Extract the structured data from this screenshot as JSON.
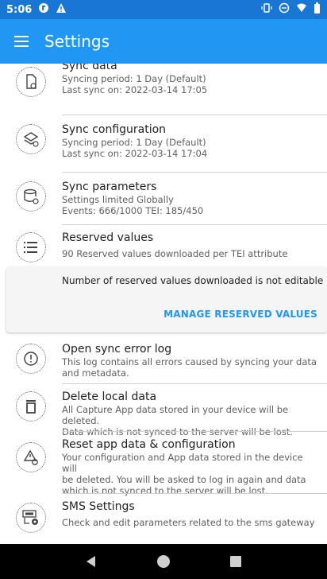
{
  "status_bar": {
    "time": "5:06"
  },
  "app_bar": {
    "title": "Settings"
  },
  "items": [
    {
      "title": "Sync data",
      "lines": [
        "Syncing period: 1 Day (Default)",
        "Last sync on: 2022-03-14 17:05"
      ],
      "icon": "sync-data-icon"
    },
    {
      "title": "Sync configuration",
      "lines": [
        "Syncing period: 1 Day (Default)",
        "Last sync on: 2022-03-14 17:04"
      ],
      "icon": "sync-configuration-icon"
    },
    {
      "title": "Sync parameters",
      "lines": [
        "Settings limited Globally",
        "Events: 666/1000 TEI: 185/450"
      ],
      "icon": "sync-parameters-icon"
    },
    {
      "title": "Reserved values",
      "lines": [
        "90 Reserved values downloaded per TEI attribute"
      ],
      "icon": "list-icon"
    },
    {
      "title": "Open sync error log",
      "lines": [
        "This log contains all errors caused by syncing your data",
        "and metadata."
      ],
      "icon": "error-icon"
    },
    {
      "title": "Delete local data",
      "lines": [
        "All Capture App data stored in your device will be deleted.",
        "Data which is not synced to the server will be lost."
      ],
      "icon": "trash-icon"
    },
    {
      "title": "Reset app data & configuration",
      "lines": [
        "Your configuration and App data stored in the device will",
        "be deleted. You will be asked to log in again and data",
        "which is not synced to the server will be lost."
      ],
      "icon": "reset-icon"
    },
    {
      "title": "SMS Settings",
      "lines": [
        "Check and edit parameters related to the sms gateway"
      ],
      "icon": "sms-settings-icon"
    }
  ],
  "reserved_panel": {
    "message": "Number of reserved values downloaded is not editable",
    "button": "MANAGE RESERVED VALUES"
  },
  "colors": {
    "status_bar": "#1976d2",
    "app_bar": "#2196f3",
    "accent": "#2196f3"
  }
}
